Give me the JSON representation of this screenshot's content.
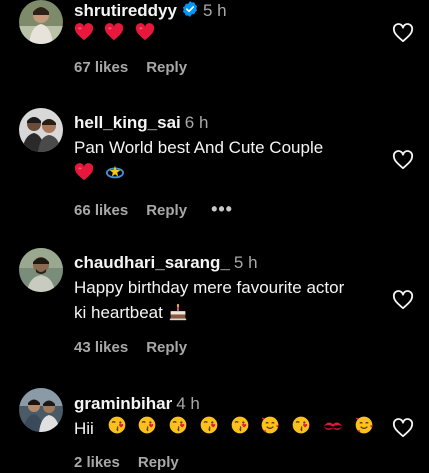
{
  "comments": [
    {
      "username": "shrutireddyy",
      "verified": true,
      "time": "5 h",
      "text": "",
      "emojis": [
        "red-heart",
        "red-heart",
        "red-heart"
      ],
      "likes": "67 likes",
      "reply": "Reply"
    },
    {
      "username": "hell_king_sai",
      "verified": false,
      "time": "6 h",
      "text": "Pan World best And Cute Couple",
      "emojis": [
        "red-heart",
        "dizzy"
      ],
      "likes": "66 likes",
      "reply": "Reply",
      "more": "•••"
    },
    {
      "username": "chaudhari_sarang_",
      "verified": false,
      "time": "5 h",
      "text": "Happy birthday mere favourite actor ki heartbeat",
      "emojis": [
        "birthday-cake"
      ],
      "likes": "43 likes",
      "reply": "Reply"
    },
    {
      "username": "graminbihar",
      "verified": false,
      "time": "4 h",
      "text": "Hii",
      "emojis": [
        "face-blowing-kiss",
        "face-blowing-kiss",
        "face-blowing-kiss",
        "face-blowing-kiss",
        "face-blowing-kiss",
        "smiling-face-with-hearts",
        "face-blowing-kiss",
        "kiss-mark",
        "smiling-face-with-hearts"
      ],
      "likes": "2 likes",
      "reply": "Reply"
    }
  ],
  "colors": {
    "background": "#000000",
    "text": "#f5f5f5",
    "muted": "#a8a8a8",
    "verified": "#0095f6",
    "heart_emoji": "#e8173c"
  },
  "icons": {
    "like_button": "heart-outline-icon",
    "verified": "verified-badge-icon"
  }
}
